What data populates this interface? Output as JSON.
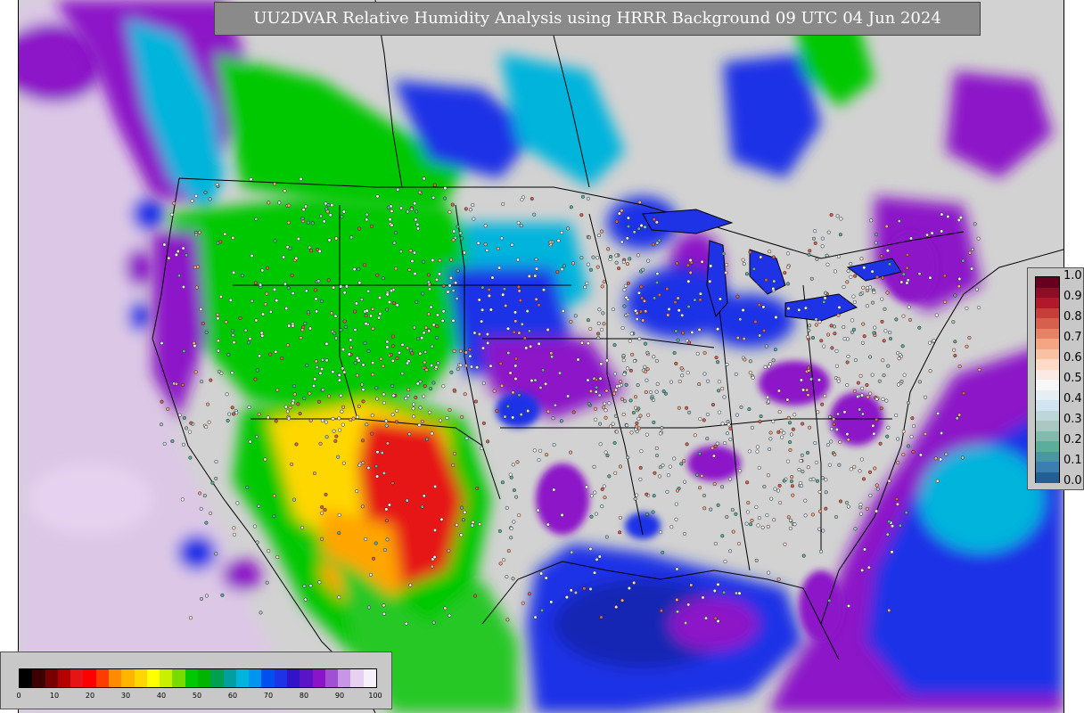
{
  "title": "UU2DVAR Relative Humidity Analysis using HRRR Background 09 UTC 04 Jun 2024",
  "colors": {
    "land_low_rh": "#d2d2d2",
    "water_rh_blue": "#1e32e6",
    "very_humid_purple": "#8c14c8",
    "dry_red": "#e61414",
    "dry_yellow": "#ffd700",
    "moist_green": "#00c800",
    "cyan": "#00b4dc"
  },
  "ratio_legend": {
    "ticks": [
      "1.0",
      "0.9",
      "0.8",
      "0.7",
      "0.6",
      "0.5",
      "0.4",
      "0.3",
      "0.2",
      "0.1",
      "0.0"
    ],
    "colors": [
      "#67001f",
      "#b2182b",
      "#d6604d",
      "#f4a582",
      "#fddbc7",
      "#f7f7f7",
      "#d1e5f0",
      "#aac7c2",
      "#5aae9a",
      "#3a7fb0",
      "#0d3d78"
    ]
  },
  "rh_legend": {
    "ticks": [
      "0",
      "10",
      "20",
      "30",
      "40",
      "50",
      "60",
      "70",
      "80",
      "90",
      "100"
    ]
  }
}
